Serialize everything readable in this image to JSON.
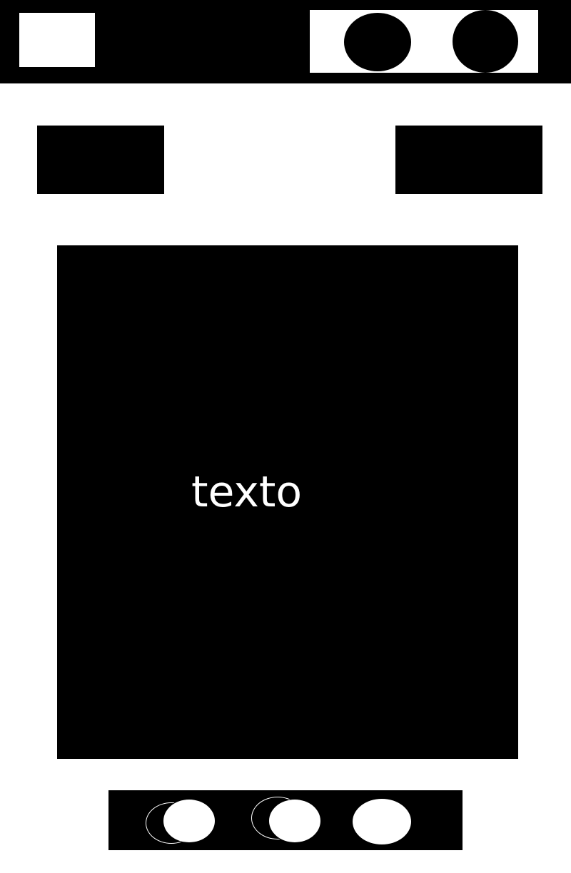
{
  "main": {
    "text": "texto"
  },
  "icons": {
    "header_left": "logo-placeholder",
    "header_right_1": "circle-icon",
    "header_right_2": "circle-icon",
    "bottom_1": "double-circle-icon",
    "bottom_2": "double-circle-icon",
    "bottom_3": "circle-icon"
  },
  "colors": {
    "primary": "#000000",
    "background": "#ffffff",
    "text_on_dark": "#ffffff"
  }
}
